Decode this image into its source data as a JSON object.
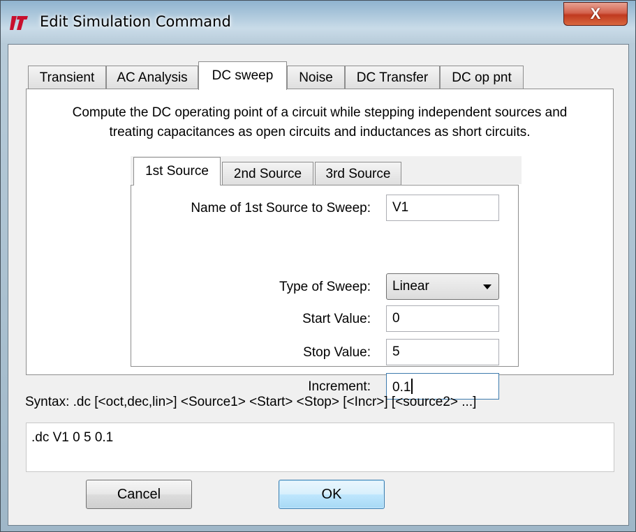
{
  "window": {
    "title": "Edit Simulation Command",
    "icon": "ltspice-logo-icon",
    "close_glyph": "X"
  },
  "tabs": [
    {
      "label": "Transient",
      "active": false
    },
    {
      "label": "AC Analysis",
      "active": false
    },
    {
      "label": "DC sweep",
      "active": true
    },
    {
      "label": "Noise",
      "active": false
    },
    {
      "label": "DC Transfer",
      "active": false
    },
    {
      "label": "DC op pnt",
      "active": false
    }
  ],
  "description": {
    "line1": "Compute the DC operating point of a circuit while stepping independent sources and",
    "line2": "treating capacitances as open circuits and inductances as short circuits."
  },
  "source_tabs": [
    {
      "label": "1st Source",
      "active": true
    },
    {
      "label": "2nd Source",
      "active": false
    },
    {
      "label": "3rd Source",
      "active": false
    }
  ],
  "form": {
    "name_label": "Name of 1st Source to Sweep:",
    "name_value": "V1",
    "type_label": "Type of Sweep:",
    "type_value": "Linear",
    "start_label": "Start Value:",
    "start_value": "0",
    "stop_label": "Stop Value:",
    "stop_value": "5",
    "increment_label": "Increment:",
    "increment_value": "0.1"
  },
  "syntax": "Syntax:  .dc [<oct,dec,lin>] <Source1> <Start> <Stop> [<Incr>] [<source2> ...]",
  "command": ".dc V1 0 5 0.1",
  "buttons": {
    "cancel": "Cancel",
    "ok": "OK"
  },
  "colors": {
    "logo_red": "#c8102e",
    "close_red": "#c03a1f",
    "default_button_border": "#3c7fb1"
  }
}
